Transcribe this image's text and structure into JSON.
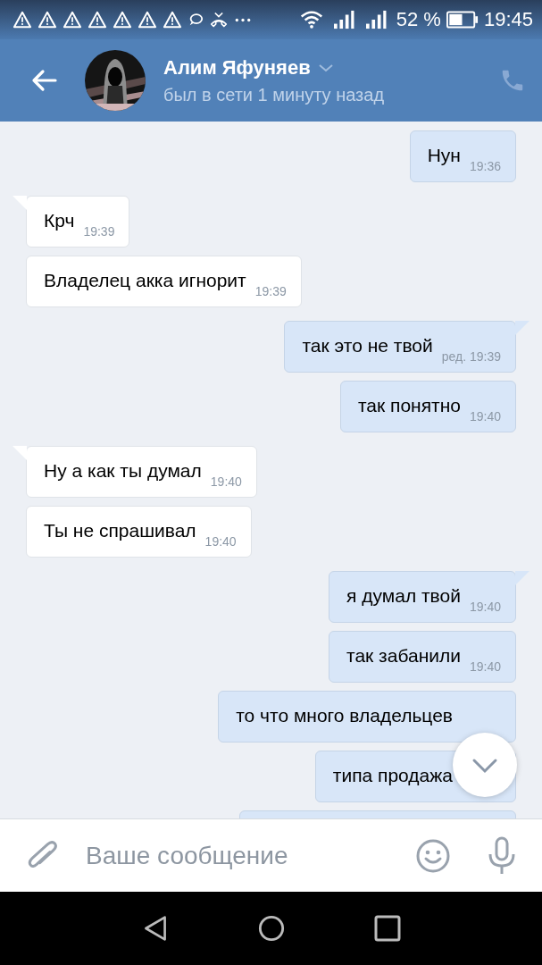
{
  "status_bar": {
    "battery": "52 %",
    "time": "19:45"
  },
  "header": {
    "name": "Алим Яфуняев",
    "status": "был в сети 1 минуту назад"
  },
  "messages": [
    {
      "outgoing": true,
      "tail": false,
      "text": "Нун",
      "time": "19:36"
    },
    {
      "outgoing": false,
      "tail": true,
      "text": "Крч",
      "time": "19:39"
    },
    {
      "outgoing": false,
      "tail": false,
      "text": "Владелец акка игнорит",
      "time": "19:39"
    },
    {
      "outgoing": true,
      "tail": true,
      "text": "так это не твой",
      "time": "ред. 19:39"
    },
    {
      "outgoing": true,
      "tail": false,
      "text": "так понятно",
      "time": "19:40"
    },
    {
      "outgoing": false,
      "tail": true,
      "text": "Ну а как ты думал",
      "time": "19:40"
    },
    {
      "outgoing": false,
      "tail": false,
      "text": "Ты не спрашивал",
      "time": "19:40"
    },
    {
      "outgoing": true,
      "tail": true,
      "text": "я думал твой",
      "time": "19:40"
    },
    {
      "outgoing": true,
      "tail": false,
      "text": "так забанили",
      "time": "19:40"
    },
    {
      "outgoing": true,
      "tail": false,
      "text": "то что много владельцев"
    },
    {
      "outgoing": true,
      "tail": false,
      "text": "типа продажа"
    }
  ],
  "composer": {
    "placeholder": "Ваше сообщение"
  }
}
